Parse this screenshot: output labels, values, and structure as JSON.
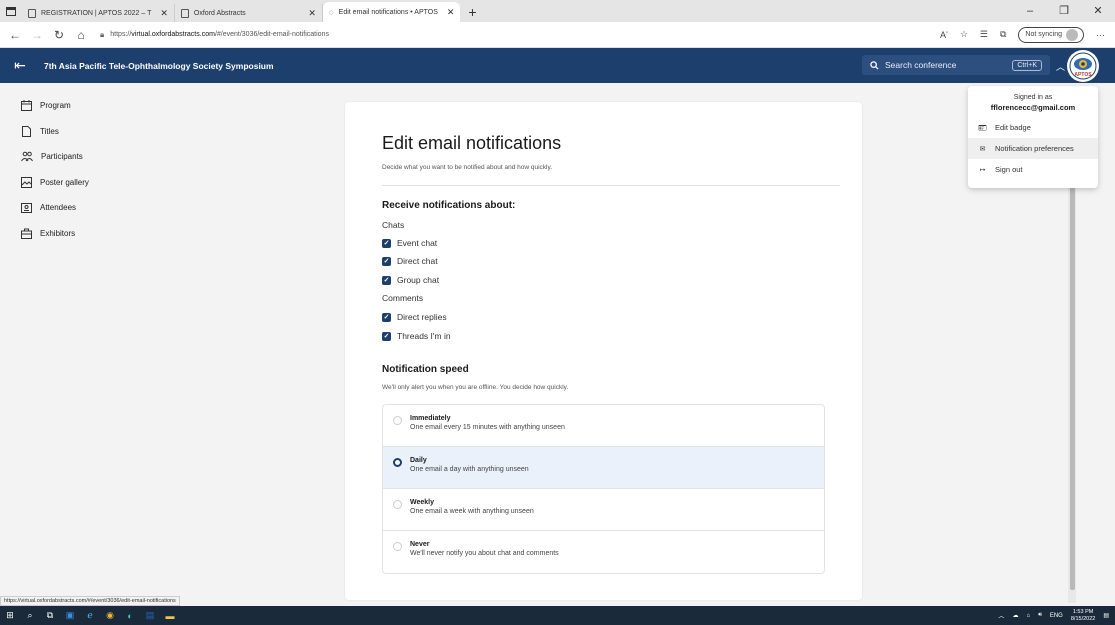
{
  "browser": {
    "tabs": [
      {
        "title": "REGISTRATION | APTOS 2022 – T",
        "active": false
      },
      {
        "title": "Oxford Abstracts",
        "active": false
      },
      {
        "title": "Edit email notifications • APTOS",
        "active": true
      }
    ],
    "url_prefix": "https://",
    "url_host": "virtual.oxfordabstracts.com",
    "url_path": "/#/event/3036/edit-email-notifications",
    "sync_label": "Not syncing",
    "status_url": "https://virtual.oxfordabstracts.com/#/event/3036/edit-email-notifications"
  },
  "header": {
    "title": "7th Asia Pacific Tele-Ophthalmology Society Symposium",
    "search_placeholder": "Search conference",
    "shortcut": "Ctrl+K",
    "logo_text": "APTOS",
    "accent_color": "#1c3f6e"
  },
  "sidebar": {
    "items": [
      {
        "label": "Program",
        "icon": "calendar-icon"
      },
      {
        "label": "Titles",
        "icon": "document-icon"
      },
      {
        "label": "Participants",
        "icon": "people-icon"
      },
      {
        "label": "Poster gallery",
        "icon": "image-icon"
      },
      {
        "label": "Attendees",
        "icon": "badge-icon"
      },
      {
        "label": "Exhibitors",
        "icon": "briefcase-icon"
      }
    ]
  },
  "page": {
    "title": "Edit email notifications",
    "subtitle": "Decide what you want to be notified about and how quickly.",
    "receive_heading": "Receive notifications about:",
    "chats_label": "Chats",
    "chat_options": [
      {
        "label": "Event chat",
        "checked": true
      },
      {
        "label": "Direct chat",
        "checked": true
      },
      {
        "label": "Group chat",
        "checked": true
      }
    ],
    "comments_label": "Comments",
    "comment_options": [
      {
        "label": "Direct replies",
        "checked": true
      },
      {
        "label": "Threads I'm in",
        "checked": true
      }
    ],
    "speed_heading": "Notification speed",
    "speed_subtitle": "We'll only alert you when you are offline. You decide how quickly.",
    "speed_options": [
      {
        "title": "Immediately",
        "desc": "One email every 15 minutes with anything unseen",
        "selected": false
      },
      {
        "title": "Daily",
        "desc": "One email a day with anything unseen",
        "selected": true
      },
      {
        "title": "Weekly",
        "desc": "One email a week with anything unseen",
        "selected": false
      },
      {
        "title": "Never",
        "desc": "We'll never notify you about chat and comments",
        "selected": false
      }
    ]
  },
  "account_menu": {
    "signed_in_label": "Signed in as",
    "email": "fflorencecc@gmail.com",
    "items": [
      {
        "label": "Edit badge",
        "icon": "badge-icon"
      },
      {
        "label": "Notification preferences",
        "icon": "mail-icon"
      },
      {
        "label": "Sign out",
        "icon": "sign-out-icon"
      }
    ]
  },
  "taskbar": {
    "language": "ENG",
    "time": "1:53 PM",
    "date": "8/15/2022"
  }
}
